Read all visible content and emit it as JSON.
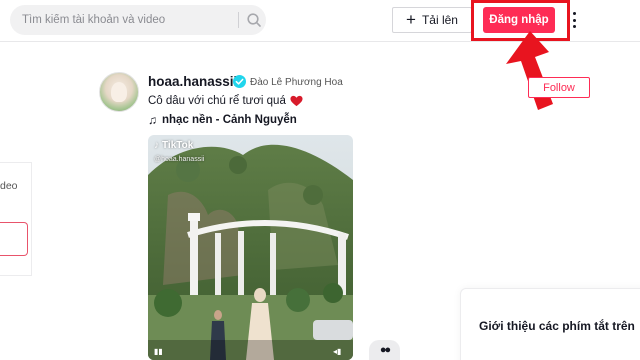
{
  "header": {
    "search": {
      "placeholder": "Tìm kiếm tài khoản và video",
      "value": ""
    },
    "upload_label": "Tải lên",
    "login_label": "Đăng nhập"
  },
  "sidebar": {
    "partial_text": "deo"
  },
  "post": {
    "username": "hoaa.hanassii",
    "display_name": "Đào Lê Phương Hoa",
    "caption": "Cô dâu với chú rể tươi quá",
    "music": "nhạc nền - Cảnh Nguyễn",
    "follow_label": "Follow",
    "video": {
      "watermark": "TikTok",
      "handle": "@hoaa.hanassii"
    }
  },
  "shortcuts": {
    "title": "Giới thiệu các phím tắt trên"
  },
  "colors": {
    "accent": "#fe2c55",
    "annotation_red": "#e8141f",
    "verified": "#20d5ec"
  },
  "icons": [
    "search-icon",
    "plus-icon",
    "more-icon",
    "verified-icon",
    "heart-icon",
    "music-note-icon",
    "tiktok-logo-icon",
    "red-arrow-annotation"
  ]
}
